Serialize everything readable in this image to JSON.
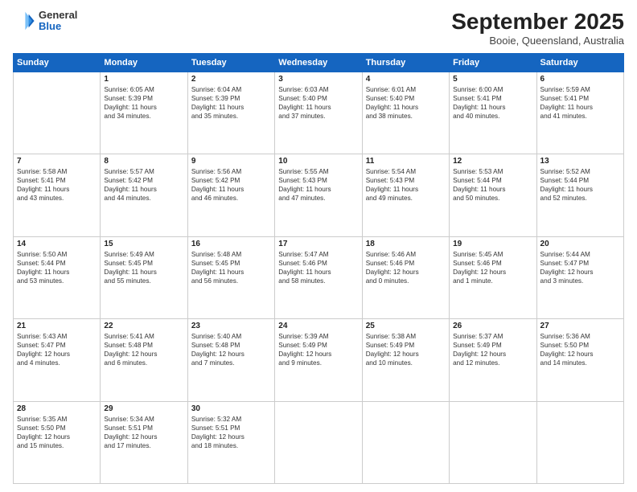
{
  "header": {
    "logo_general": "General",
    "logo_blue": "Blue",
    "month": "September 2025",
    "location": "Booie, Queensland, Australia"
  },
  "weekdays": [
    "Sunday",
    "Monday",
    "Tuesday",
    "Wednesday",
    "Thursday",
    "Friday",
    "Saturday"
  ],
  "weeks": [
    [
      {
        "day": "",
        "info": ""
      },
      {
        "day": "1",
        "info": "Sunrise: 6:05 AM\nSunset: 5:39 PM\nDaylight: 11 hours\nand 34 minutes."
      },
      {
        "day": "2",
        "info": "Sunrise: 6:04 AM\nSunset: 5:39 PM\nDaylight: 11 hours\nand 35 minutes."
      },
      {
        "day": "3",
        "info": "Sunrise: 6:03 AM\nSunset: 5:40 PM\nDaylight: 11 hours\nand 37 minutes."
      },
      {
        "day": "4",
        "info": "Sunrise: 6:01 AM\nSunset: 5:40 PM\nDaylight: 11 hours\nand 38 minutes."
      },
      {
        "day": "5",
        "info": "Sunrise: 6:00 AM\nSunset: 5:41 PM\nDaylight: 11 hours\nand 40 minutes."
      },
      {
        "day": "6",
        "info": "Sunrise: 5:59 AM\nSunset: 5:41 PM\nDaylight: 11 hours\nand 41 minutes."
      }
    ],
    [
      {
        "day": "7",
        "info": "Sunrise: 5:58 AM\nSunset: 5:41 PM\nDaylight: 11 hours\nand 43 minutes."
      },
      {
        "day": "8",
        "info": "Sunrise: 5:57 AM\nSunset: 5:42 PM\nDaylight: 11 hours\nand 44 minutes."
      },
      {
        "day": "9",
        "info": "Sunrise: 5:56 AM\nSunset: 5:42 PM\nDaylight: 11 hours\nand 46 minutes."
      },
      {
        "day": "10",
        "info": "Sunrise: 5:55 AM\nSunset: 5:43 PM\nDaylight: 11 hours\nand 47 minutes."
      },
      {
        "day": "11",
        "info": "Sunrise: 5:54 AM\nSunset: 5:43 PM\nDaylight: 11 hours\nand 49 minutes."
      },
      {
        "day": "12",
        "info": "Sunrise: 5:53 AM\nSunset: 5:44 PM\nDaylight: 11 hours\nand 50 minutes."
      },
      {
        "day": "13",
        "info": "Sunrise: 5:52 AM\nSunset: 5:44 PM\nDaylight: 11 hours\nand 52 minutes."
      }
    ],
    [
      {
        "day": "14",
        "info": "Sunrise: 5:50 AM\nSunset: 5:44 PM\nDaylight: 11 hours\nand 53 minutes."
      },
      {
        "day": "15",
        "info": "Sunrise: 5:49 AM\nSunset: 5:45 PM\nDaylight: 11 hours\nand 55 minutes."
      },
      {
        "day": "16",
        "info": "Sunrise: 5:48 AM\nSunset: 5:45 PM\nDaylight: 11 hours\nand 56 minutes."
      },
      {
        "day": "17",
        "info": "Sunrise: 5:47 AM\nSunset: 5:46 PM\nDaylight: 11 hours\nand 58 minutes."
      },
      {
        "day": "18",
        "info": "Sunrise: 5:46 AM\nSunset: 5:46 PM\nDaylight: 12 hours\nand 0 minutes."
      },
      {
        "day": "19",
        "info": "Sunrise: 5:45 AM\nSunset: 5:46 PM\nDaylight: 12 hours\nand 1 minute."
      },
      {
        "day": "20",
        "info": "Sunrise: 5:44 AM\nSunset: 5:47 PM\nDaylight: 12 hours\nand 3 minutes."
      }
    ],
    [
      {
        "day": "21",
        "info": "Sunrise: 5:43 AM\nSunset: 5:47 PM\nDaylight: 12 hours\nand 4 minutes."
      },
      {
        "day": "22",
        "info": "Sunrise: 5:41 AM\nSunset: 5:48 PM\nDaylight: 12 hours\nand 6 minutes."
      },
      {
        "day": "23",
        "info": "Sunrise: 5:40 AM\nSunset: 5:48 PM\nDaylight: 12 hours\nand 7 minutes."
      },
      {
        "day": "24",
        "info": "Sunrise: 5:39 AM\nSunset: 5:49 PM\nDaylight: 12 hours\nand 9 minutes."
      },
      {
        "day": "25",
        "info": "Sunrise: 5:38 AM\nSunset: 5:49 PM\nDaylight: 12 hours\nand 10 minutes."
      },
      {
        "day": "26",
        "info": "Sunrise: 5:37 AM\nSunset: 5:49 PM\nDaylight: 12 hours\nand 12 minutes."
      },
      {
        "day": "27",
        "info": "Sunrise: 5:36 AM\nSunset: 5:50 PM\nDaylight: 12 hours\nand 14 minutes."
      }
    ],
    [
      {
        "day": "28",
        "info": "Sunrise: 5:35 AM\nSunset: 5:50 PM\nDaylight: 12 hours\nand 15 minutes."
      },
      {
        "day": "29",
        "info": "Sunrise: 5:34 AM\nSunset: 5:51 PM\nDaylight: 12 hours\nand 17 minutes."
      },
      {
        "day": "30",
        "info": "Sunrise: 5:32 AM\nSunset: 5:51 PM\nDaylight: 12 hours\nand 18 minutes."
      },
      {
        "day": "",
        "info": ""
      },
      {
        "day": "",
        "info": ""
      },
      {
        "day": "",
        "info": ""
      },
      {
        "day": "",
        "info": ""
      }
    ]
  ]
}
